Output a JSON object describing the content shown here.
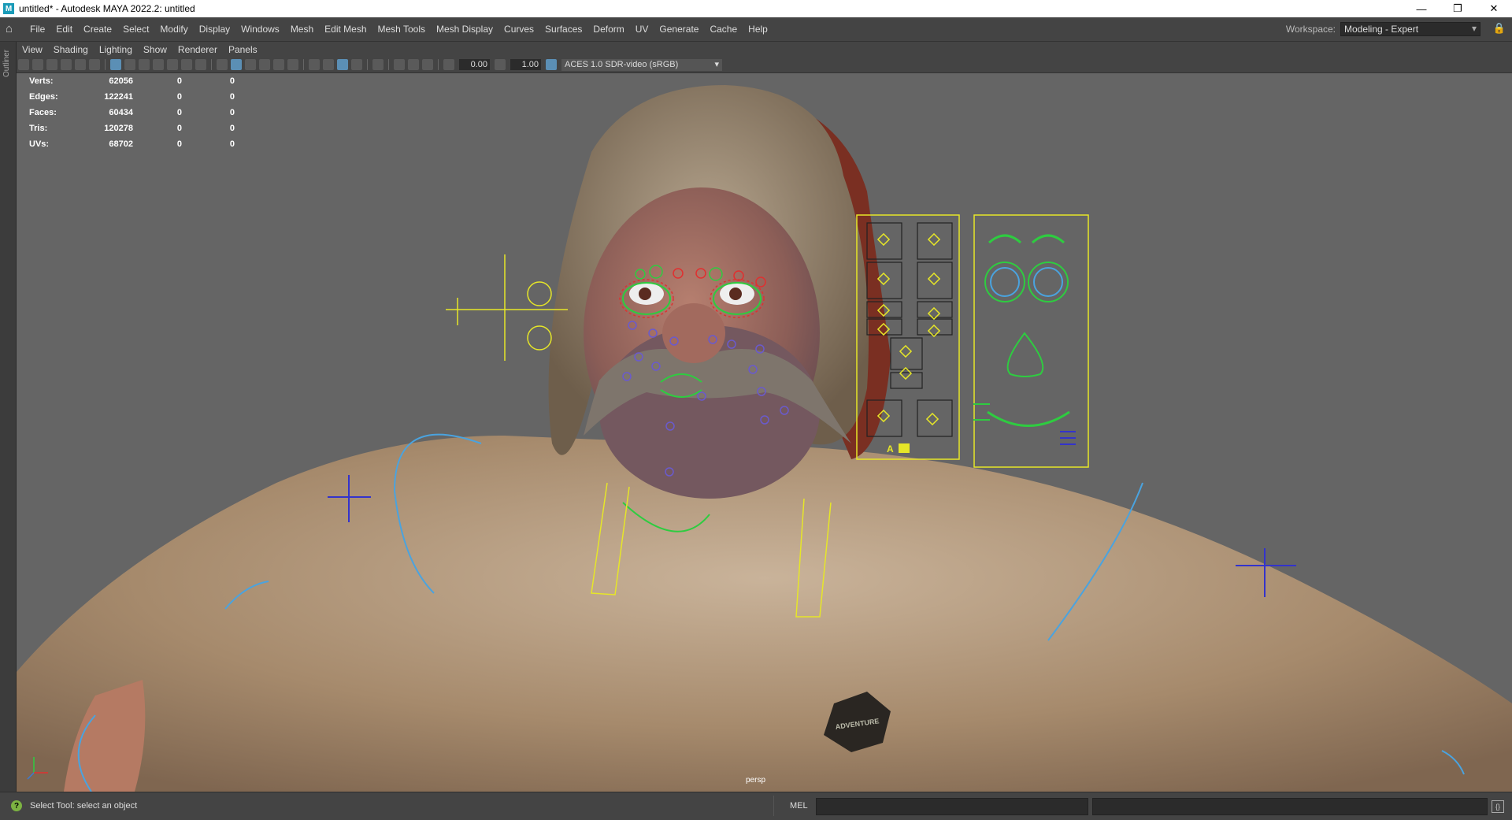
{
  "window": {
    "title": "untitled* - Autodesk MAYA 2022.2: untitled",
    "app_icon": "M",
    "controls": [
      "—",
      "❐",
      "✕"
    ]
  },
  "menubar": {
    "items": [
      "File",
      "Edit",
      "Create",
      "Select",
      "Modify",
      "Display",
      "Windows",
      "Mesh",
      "Edit Mesh",
      "Mesh Tools",
      "Mesh Display",
      "Curves",
      "Surfaces",
      "Deform",
      "UV",
      "Generate",
      "Cache",
      "Help"
    ],
    "workspace_label": "Workspace:",
    "workspace_value": "Modeling - Expert"
  },
  "outliner_tab": "Outliner",
  "panel_menu": [
    "View",
    "Shading",
    "Lighting",
    "Show",
    "Renderer",
    "Panels"
  ],
  "toolbar": {
    "field1": "0.00",
    "field2": "1.00",
    "color_space": "ACES 1.0 SDR-video (sRGB)"
  },
  "hud": {
    "rows": [
      {
        "label": "Verts:",
        "v1": "62056",
        "v2": "0",
        "v3": "0"
      },
      {
        "label": "Edges:",
        "v1": "122241",
        "v2": "0",
        "v3": "0"
      },
      {
        "label": "Faces:",
        "v1": "60434",
        "v2": "0",
        "v3": "0"
      },
      {
        "label": "Tris:",
        "v1": "120278",
        "v2": "0",
        "v3": "0"
      },
      {
        "label": "UVs:",
        "v1": "68702",
        "v2": "0",
        "v3": "0"
      }
    ]
  },
  "viewport": {
    "camera": "persp",
    "shirt_logo": "ADVENTURE",
    "panel_letter": "A"
  },
  "status": {
    "help_icon": "?",
    "message": "Select Tool: select an object",
    "mel_label": "MEL",
    "script_icon": "{}"
  }
}
